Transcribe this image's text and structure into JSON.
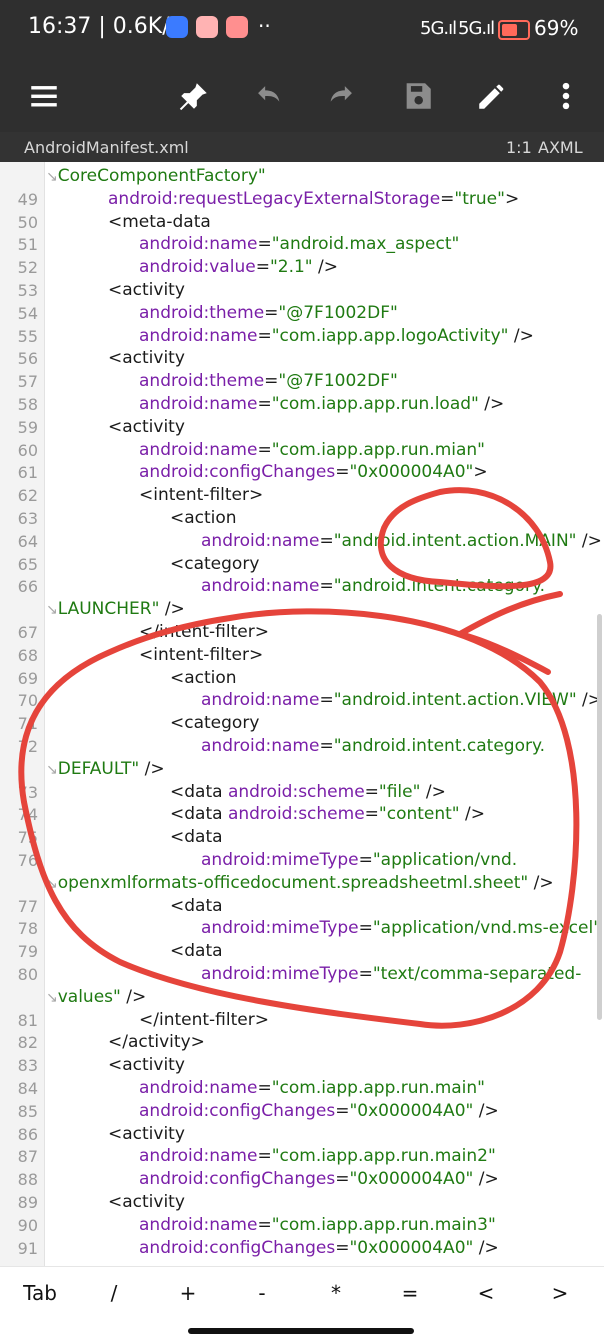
{
  "status": {
    "time_speed": "16:37 | 0.6K/s",
    "extra": "··",
    "sig1": "5G.ıl",
    "sig2": "5G.ıl",
    "battery_pct": "69%",
    "battery_level": 0.69
  },
  "toolbar": {
    "menu_icon": "menu-icon",
    "pin_icon": "pin-icon",
    "undo_icon": "undo-icon",
    "redo_icon": "redo-icon",
    "save_icon": "save-icon",
    "edit_icon": "edit-icon",
    "more_icon": "more-icon"
  },
  "file": {
    "name": "AndroidManifest.xml",
    "position": "1:1",
    "mode": "AXML"
  },
  "editor": {
    "continuation_line": "CoreComponentFactory\"",
    "lines": [
      {
        "n": "49",
        "parts": [
          [
            "attr",
            "android:requestLegacyExternalStorage"
          ],
          [
            "tag",
            "="
          ],
          [
            "val",
            "\"true\""
          ],
          [
            "tag",
            ">"
          ]
        ]
      },
      {
        "n": "50",
        "parts": [
          [
            "tag",
            "<meta-data"
          ]
        ]
      },
      {
        "n": "51",
        "parts": [
          [
            "attr",
            "android:name"
          ],
          [
            "tag",
            "="
          ],
          [
            "val",
            "\"android.max_aspect\""
          ]
        ]
      },
      {
        "n": "52",
        "parts": [
          [
            "attr",
            "android:value"
          ],
          [
            "tag",
            "="
          ],
          [
            "val",
            "\"2.1\""
          ],
          [
            "tag",
            " />"
          ]
        ]
      },
      {
        "n": "53",
        "parts": [
          [
            "tag",
            "<activity"
          ]
        ]
      },
      {
        "n": "54",
        "parts": [
          [
            "attr",
            "android:theme"
          ],
          [
            "tag",
            "="
          ],
          [
            "val",
            "\"@7F1002DF\""
          ]
        ]
      },
      {
        "n": "55",
        "parts": [
          [
            "attr",
            "android:name"
          ],
          [
            "tag",
            "="
          ],
          [
            "val",
            "\"com.iapp.app.logoActivity\""
          ],
          [
            "tag",
            " />"
          ]
        ]
      },
      {
        "n": "56",
        "parts": [
          [
            "tag",
            "<activity"
          ]
        ]
      },
      {
        "n": "57",
        "parts": [
          [
            "attr",
            "android:theme"
          ],
          [
            "tag",
            "="
          ],
          [
            "val",
            "\"@7F1002DF\""
          ]
        ]
      },
      {
        "n": "58",
        "parts": [
          [
            "attr",
            "android:name"
          ],
          [
            "tag",
            "="
          ],
          [
            "val",
            "\"com.iapp.app.run.load\""
          ],
          [
            "tag",
            " />"
          ]
        ]
      },
      {
        "n": "59",
        "parts": [
          [
            "tag",
            "<activity"
          ]
        ]
      },
      {
        "n": "60",
        "parts": [
          [
            "attr",
            "android:name"
          ],
          [
            "tag",
            "="
          ],
          [
            "val",
            "\"com.iapp.app.run.mian\""
          ]
        ]
      },
      {
        "n": "61",
        "parts": [
          [
            "attr",
            "android:configChanges"
          ],
          [
            "tag",
            "="
          ],
          [
            "val",
            "\"0x000004A0\""
          ],
          [
            "tag",
            ">"
          ]
        ]
      },
      {
        "n": "62",
        "parts": [
          [
            "tag",
            "<intent-filter>"
          ]
        ]
      },
      {
        "n": "63",
        "parts": [
          [
            "tag",
            "<action"
          ]
        ]
      },
      {
        "n": "64",
        "parts": [
          [
            "attr",
            "android:name"
          ],
          [
            "tag",
            "="
          ],
          [
            "val",
            "\"android.intent.action.MAIN\""
          ],
          [
            "tag",
            " />"
          ]
        ]
      },
      {
        "n": "65",
        "parts": [
          [
            "tag",
            "<category"
          ]
        ]
      },
      {
        "n": "66",
        "parts": [
          [
            "attr",
            "android:name"
          ],
          [
            "tag",
            "="
          ],
          [
            "val",
            "\"android.intent.category."
          ]
        ]
      },
      {
        "n": "",
        "parts": [
          [
            "val",
            "LAUNCHER\""
          ],
          [
            "tag",
            " />"
          ]
        ]
      },
      {
        "n": "67",
        "parts": [
          [
            "tag",
            "</intent-filter>"
          ]
        ]
      },
      {
        "n": "68",
        "parts": [
          [
            "tag",
            "<intent-filter>"
          ]
        ]
      },
      {
        "n": "69",
        "parts": [
          [
            "tag",
            "<action"
          ]
        ]
      },
      {
        "n": "70",
        "parts": [
          [
            "attr",
            "android:name"
          ],
          [
            "tag",
            "="
          ],
          [
            "val",
            "\"android.intent.action.VIEW\""
          ],
          [
            "tag",
            " />"
          ]
        ]
      },
      {
        "n": "71",
        "parts": [
          [
            "tag",
            "<category"
          ]
        ]
      },
      {
        "n": "72",
        "parts": [
          [
            "attr",
            "android:name"
          ],
          [
            "tag",
            "="
          ],
          [
            "val",
            "\"android.intent.category."
          ]
        ]
      },
      {
        "n": "",
        "parts": [
          [
            "val",
            "DEFAULT\""
          ],
          [
            "tag",
            " />"
          ]
        ]
      },
      {
        "n": "73",
        "parts": [
          [
            "tag",
            "<data "
          ],
          [
            "attr",
            "android:scheme"
          ],
          [
            "tag",
            "="
          ],
          [
            "val",
            "\"file\""
          ],
          [
            "tag",
            " />"
          ]
        ]
      },
      {
        "n": "74",
        "parts": [
          [
            "tag",
            "<data "
          ],
          [
            "attr",
            "android:scheme"
          ],
          [
            "tag",
            "="
          ],
          [
            "val",
            "\"content\""
          ],
          [
            "tag",
            " />"
          ]
        ]
      },
      {
        "n": "75",
        "parts": [
          [
            "tag",
            "<data"
          ]
        ]
      },
      {
        "n": "76",
        "parts": [
          [
            "attr",
            "android:mimeType"
          ],
          [
            "tag",
            "="
          ],
          [
            "val",
            "\"application/vnd."
          ]
        ]
      },
      {
        "n": "",
        "parts": [
          [
            "val",
            "openxmlformats-officedocument.spreadsheetml.sheet\""
          ],
          [
            "tag",
            " />"
          ]
        ]
      },
      {
        "n": "77",
        "parts": [
          [
            "tag",
            "<data"
          ]
        ]
      },
      {
        "n": "78",
        "parts": [
          [
            "attr",
            "android:mimeType"
          ],
          [
            "tag",
            "="
          ],
          [
            "val",
            "\"application/vnd.ms-excel\""
          ],
          [
            "tag",
            " />"
          ]
        ]
      },
      {
        "n": "79",
        "parts": [
          [
            "tag",
            "<data"
          ]
        ]
      },
      {
        "n": "80",
        "parts": [
          [
            "attr",
            "android:mimeType"
          ],
          [
            "tag",
            "="
          ],
          [
            "val",
            "\"text/comma-separated-"
          ]
        ]
      },
      {
        "n": "",
        "parts": [
          [
            "val",
            "values\""
          ],
          [
            "tag",
            " />"
          ]
        ]
      },
      {
        "n": "81",
        "parts": [
          [
            "tag",
            "</intent-filter>"
          ]
        ]
      },
      {
        "n": "82",
        "parts": [
          [
            "tag",
            "</activity>"
          ]
        ]
      },
      {
        "n": "83",
        "parts": [
          [
            "tag",
            "<activity"
          ]
        ]
      },
      {
        "n": "84",
        "parts": [
          [
            "attr",
            "android:name"
          ],
          [
            "tag",
            "="
          ],
          [
            "val",
            "\"com.iapp.app.run.main\""
          ]
        ]
      },
      {
        "n": "85",
        "parts": [
          [
            "attr",
            "android:configChanges"
          ],
          [
            "tag",
            "="
          ],
          [
            "val",
            "\"0x000004A0\""
          ],
          [
            "tag",
            " />"
          ]
        ]
      },
      {
        "n": "86",
        "parts": [
          [
            "tag",
            "<activity"
          ]
        ]
      },
      {
        "n": "87",
        "parts": [
          [
            "attr",
            "android:name"
          ],
          [
            "tag",
            "="
          ],
          [
            "val",
            "\"com.iapp.app.run.main2\""
          ]
        ]
      },
      {
        "n": "88",
        "parts": [
          [
            "attr",
            "android:configChanges"
          ],
          [
            "tag",
            "="
          ],
          [
            "val",
            "\"0x000004A0\""
          ],
          [
            "tag",
            " />"
          ]
        ]
      },
      {
        "n": "89",
        "parts": [
          [
            "tag",
            "<activity"
          ]
        ]
      },
      {
        "n": "90",
        "parts": [
          [
            "attr",
            "android:name"
          ],
          [
            "tag",
            "="
          ],
          [
            "val",
            "\"com.iapp.app.run.main3\""
          ]
        ]
      },
      {
        "n": "91",
        "parts": [
          [
            "attr",
            "android:configChanges"
          ],
          [
            "tag",
            "="
          ],
          [
            "val",
            "\"0x000004A0\""
          ],
          [
            "tag",
            " />"
          ]
        ]
      }
    ]
  },
  "keys": [
    "Tab",
    "/",
    "+",
    "-",
    "*",
    "=",
    "<",
    ">"
  ],
  "colors": {
    "toolbar_bg": "#2f2f2f",
    "attribute": "#7a1fa8",
    "value": "#1f7a12",
    "annotation": "#e5443b"
  }
}
